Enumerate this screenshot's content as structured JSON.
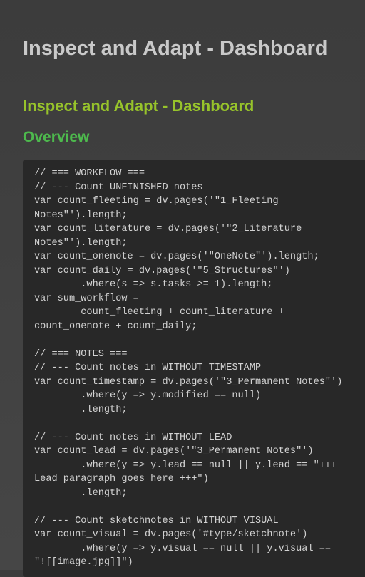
{
  "page": {
    "title": "Inspect and Adapt - Dashboard",
    "heading": "Inspect and Adapt - Dashboard",
    "section": "Overview"
  },
  "code_lines": [
    "// === WORKFLOW ===",
    "// --- Count UNFINISHED notes",
    "var count_fleeting = dv.pages('\"1_Fleeting",
    "Notes\"').length;",
    "var count_literature = dv.pages('\"2_Literature",
    "Notes\"').length;",
    "var count_onenote = dv.pages('\"OneNote\"').length;",
    "var count_daily = dv.pages('\"5_Structures\"')",
    "        .where(s => s.tasks >= 1).length;",
    "var sum_workflow =",
    "        count_fleeting + count_literature +",
    "count_onenote + count_daily;",
    "",
    "// === NOTES ===",
    "// --- Count notes in WITHOUT TIMESTAMP",
    "var count_timestamp = dv.pages('\"3_Permanent Notes\"')",
    "        .where(y => y.modified == null)",
    "        .length;",
    "",
    "// --- Count notes in WITHOUT LEAD",
    "var count_lead = dv.pages('\"3_Permanent Notes\"')",
    "        .where(y => y.lead == null || y.lead == \"+++",
    "Lead paragraph goes here +++\")",
    "        .length;",
    "",
    "// --- Count sketchnotes in WITHOUT VISUAL",
    "var count_visual = dv.pages('#type/sketchnote')",
    "        .where(y => y.visual == null || y.visual ==",
    "\"![[image.jpg]]\")"
  ]
}
